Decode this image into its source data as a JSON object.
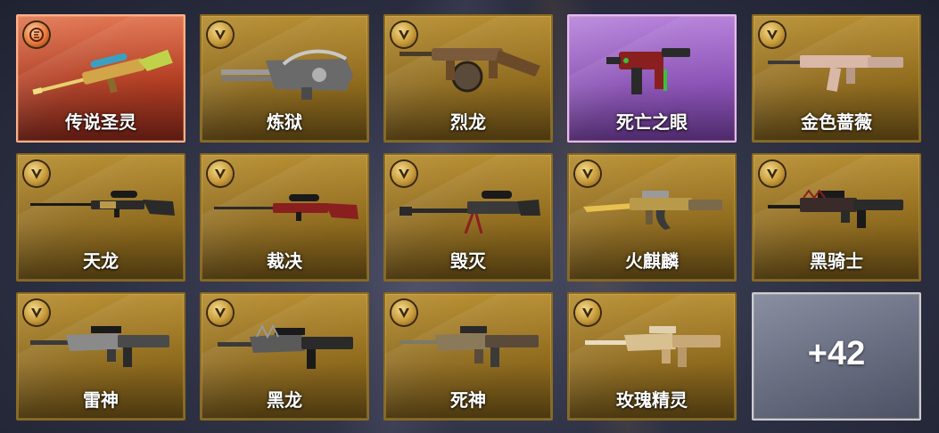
{
  "items": [
    {
      "name": "传说圣灵",
      "rarity": "legendary",
      "badge": "legend-coin-icon",
      "weapon": "sniper-rifle-icon",
      "color": "#d2a548"
    },
    {
      "name": "炼狱",
      "rarity": "gold",
      "badge": "v-badge-icon",
      "weapon": "gatling-gun-icon",
      "color": "#8a8a8a"
    },
    {
      "name": "烈龙",
      "rarity": "gold",
      "badge": "v-badge-icon",
      "weapon": "tommy-gun-icon",
      "color": "#6b4a2a"
    },
    {
      "name": "死亡之眼",
      "rarity": "purple",
      "badge": "none",
      "weapon": "smg-icon",
      "color": "#8a1f1f"
    },
    {
      "name": "金色蔷薇",
      "rarity": "gold",
      "badge": "v-badge-icon",
      "weapon": "assault-rifle-icon",
      "color": "#d9b8a8"
    },
    {
      "name": "天龙",
      "rarity": "gold",
      "badge": "v-badge-icon",
      "weapon": "sniper-rifle-icon",
      "color": "#2a2a2a"
    },
    {
      "name": "裁决",
      "rarity": "gold",
      "badge": "v-badge-icon",
      "weapon": "sniper-rifle-icon",
      "color": "#8a1f1f"
    },
    {
      "name": "毁灭",
      "rarity": "gold",
      "badge": "v-badge-icon",
      "weapon": "heavy-sniper-icon",
      "color": "#2a2a2a"
    },
    {
      "name": "火麒麟",
      "rarity": "gold",
      "badge": "v-badge-icon",
      "weapon": "ak-rifle-icon",
      "color": "#b89a4a"
    },
    {
      "name": "黑骑士",
      "rarity": "gold",
      "badge": "v-badge-icon",
      "weapon": "m4-rifle-icon",
      "color": "#2a2a2a"
    },
    {
      "name": "雷神",
      "rarity": "gold",
      "badge": "v-badge-icon",
      "weapon": "m4-rifle-icon",
      "color": "#3a3a3a"
    },
    {
      "name": "黑龙",
      "rarity": "gold",
      "badge": "v-badge-icon",
      "weapon": "m4-rifle-icon",
      "color": "#2a2a2a"
    },
    {
      "name": "死神",
      "rarity": "gold",
      "badge": "v-badge-icon",
      "weapon": "m4-rifle-icon",
      "color": "#5a4a3a"
    },
    {
      "name": "玫瑰精灵",
      "rarity": "gold",
      "badge": "v-badge-icon",
      "weapon": "m4-rifle-icon",
      "color": "#c9a877"
    }
  ],
  "more": {
    "label": "+42"
  }
}
